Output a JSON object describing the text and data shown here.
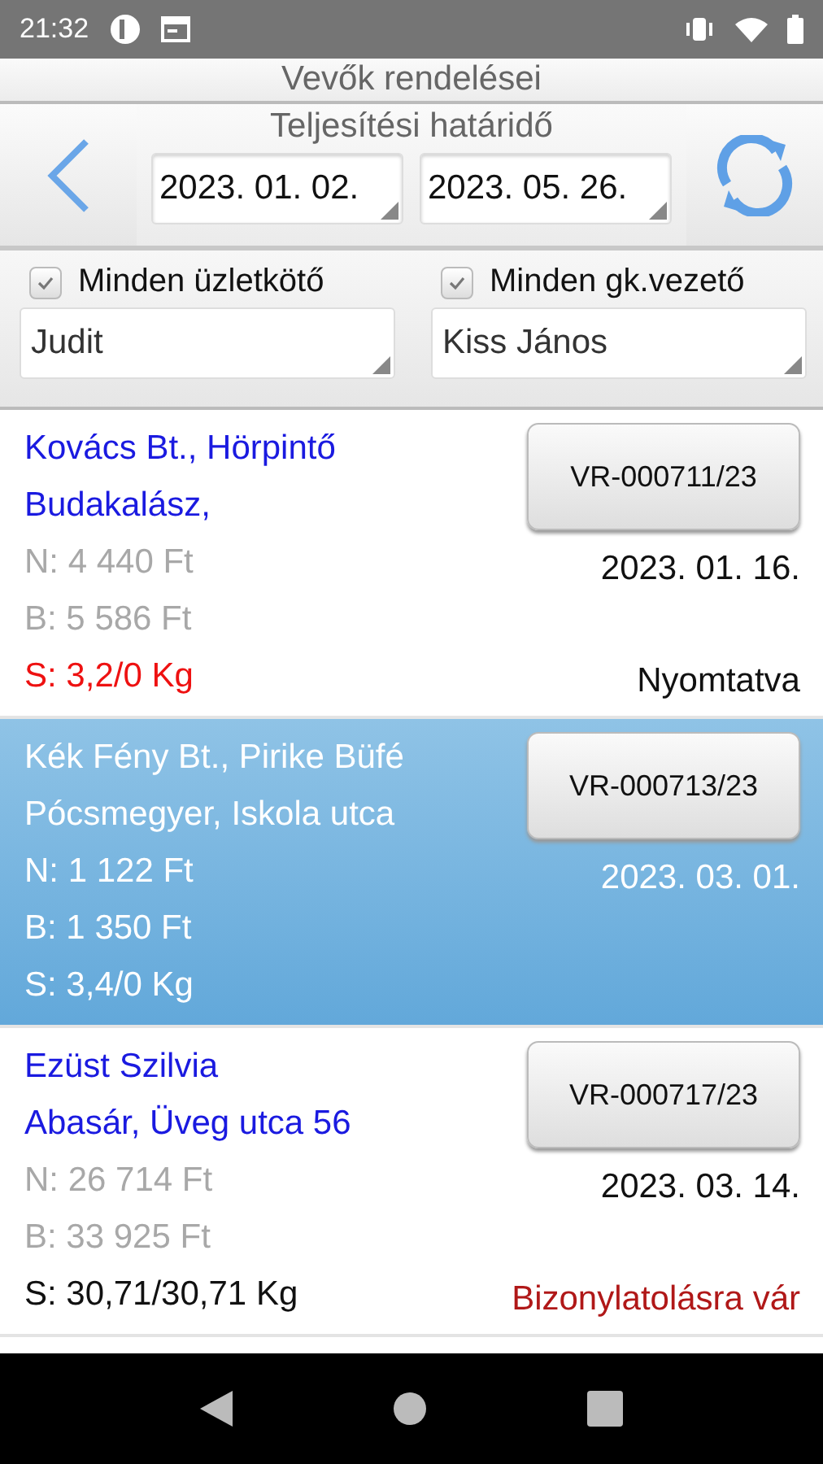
{
  "status_bar": {
    "time": "21:32"
  },
  "title": "Vevők rendelései",
  "date_filter": {
    "label": "Teljesítési határidő",
    "from": "2023. 01. 02.",
    "to": "2023. 05. 26."
  },
  "filters": [
    {
      "label": "Minden üzletkötő",
      "checked": true,
      "value": "Judit"
    },
    {
      "label": "Minden gk.vezető",
      "checked": true,
      "value": "Kiss János"
    }
  ],
  "orders": [
    {
      "name": "Kovács Bt., Hörpintő",
      "address": "Budakalász,",
      "net": "N: 4 440 Ft",
      "gross": "B: 5 586 Ft",
      "amounts_disabled": true,
      "weight": "S: 3,2/0 Kg",
      "weight_alert": true,
      "number": "VR-000711/23",
      "date": "2023. 01. 16.",
      "status": "Nyomtatva",
      "status_alert": false,
      "selected": false
    },
    {
      "name": "Kék Fény Bt., Pirike Büfé",
      "address": "Pócsmegyer, Iskola utca",
      "net": "N: 1 122 Ft",
      "gross": "B: 1 350 Ft",
      "amounts_disabled": false,
      "weight": "S: 3,4/0 Kg",
      "weight_alert": false,
      "number": "VR-000713/23",
      "date": "2023. 03. 01.",
      "selected": true
    },
    {
      "name": "Ezüst Szilvia",
      "address": "Abasár, Üveg utca 56",
      "net": "N: 26 714 Ft",
      "gross": "B: 33 925 Ft",
      "amounts_disabled": true,
      "weight": "S: 30,71/30,71 Kg",
      "weight_alert": false,
      "number": "VR-000717/23",
      "date": "2023. 03. 14.",
      "status": "Bizonylatolásra vár",
      "status_alert": true,
      "selected": false
    }
  ]
}
